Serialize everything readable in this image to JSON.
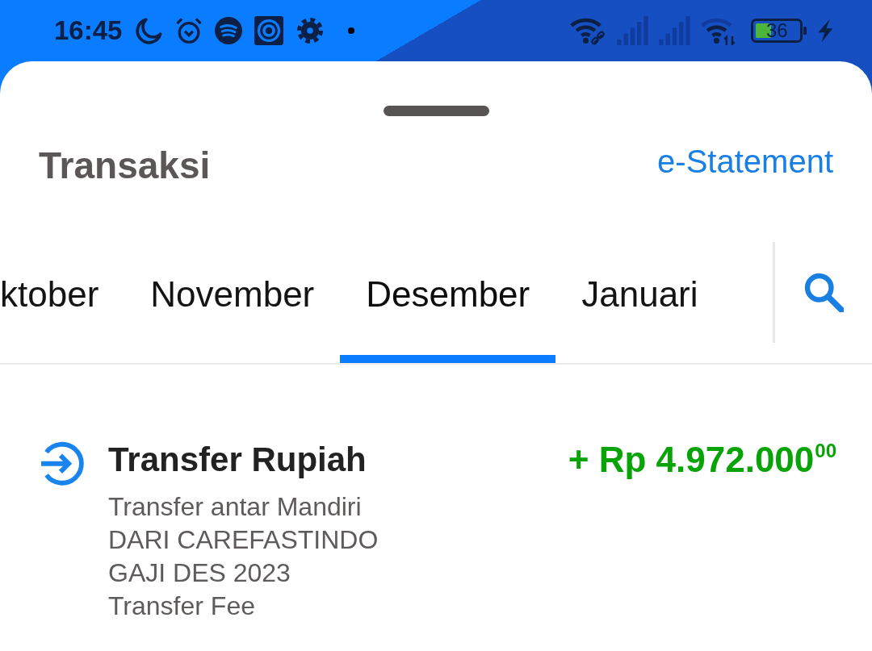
{
  "status_bar": {
    "time": "16:45",
    "battery": "36"
  },
  "header": {
    "title": "Transaksi",
    "link": "e-Statement"
  },
  "month_tabs": [
    {
      "label": "ktober",
      "selected": false
    },
    {
      "label": "November",
      "selected": false
    },
    {
      "label": "Desember",
      "selected": true
    },
    {
      "label": "Januari",
      "selected": false
    }
  ],
  "transactions": [
    {
      "kind": "incoming",
      "title": "Transfer Rupiah",
      "amount": "+ Rp 4.972.000$^{00}$",
      "description": [
        "Transfer antar Mandiri",
        "DARI CAREFASTINDO",
        "GAJI DES 2023",
        "Transfer Fee"
      ]
    }
  ]
}
